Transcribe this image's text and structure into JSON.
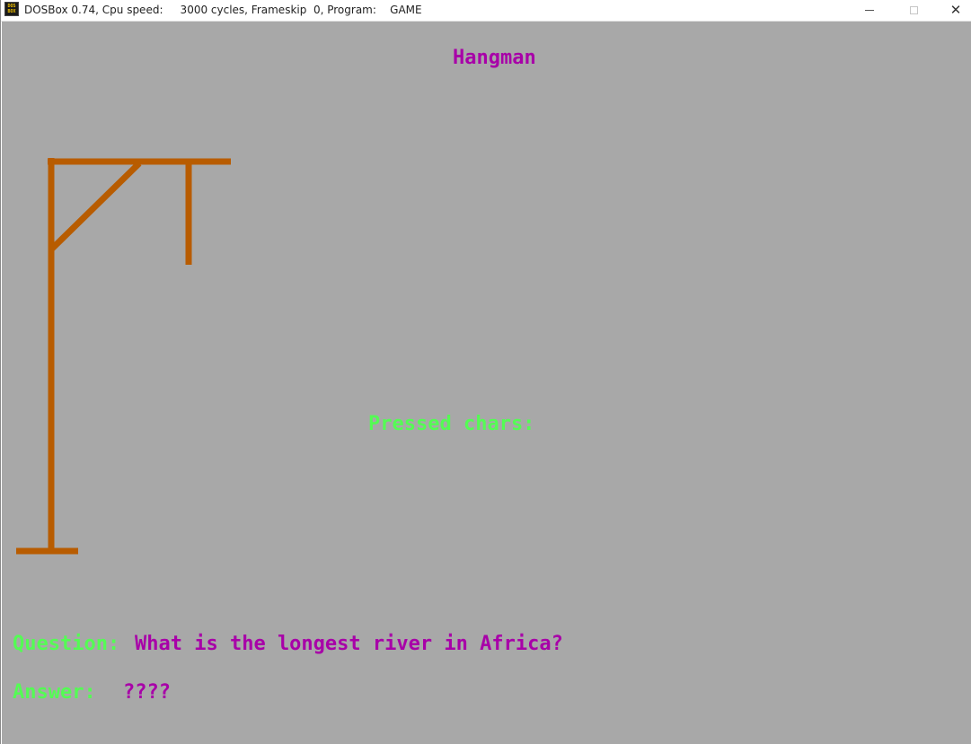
{
  "window": {
    "title": "DOSBox 0.74, Cpu speed:     3000 cycles, Frameskip  0, Program:    GAME",
    "icon_name": "dosbox-icon",
    "icon_text_top": "DOS",
    "icon_text_bottom": "BOX"
  },
  "game": {
    "title": "Hangman",
    "pressed_label": "Pressed chars:",
    "pressed_chars": "",
    "question_label": "Question:",
    "question_text": "What is the longest river in Africa?",
    "answer_label": "Answer:",
    "answer_value": "????",
    "colors": {
      "background": "#a8a8a8",
      "magenta": "#a800a8",
      "green": "#54fc54",
      "gallows": "#b85c00"
    }
  }
}
